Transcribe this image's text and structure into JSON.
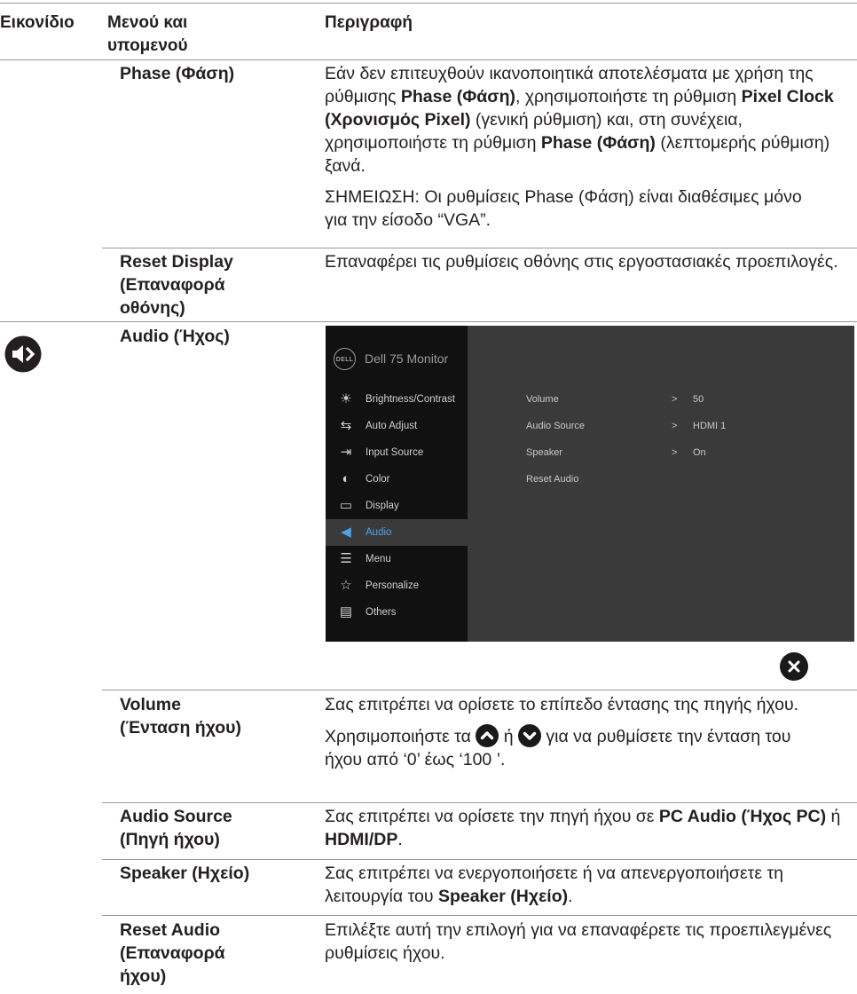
{
  "headers": {
    "icon": "Εικονίδιο",
    "menu": "Μενού και υπομενού",
    "description": "Περιγραφή"
  },
  "rows": {
    "phase": {
      "name": "Phase (Φάση)",
      "d1_a": "Εάν δεν επιτευχθούν ικανοποιητικά αποτελέσματα με χρήση της ρύθμισης ",
      "d1_b": "Phase (Φάση)",
      "d1_c": ", χρησιμοποιήστε τη ρύθμιση ",
      "d1_d": "Pixel Clock (Χρονισμός Pixel)",
      "d1_e": " (γενική ρύθμιση) και, στη συνέχεια, χρησιμοποιήστε τη ρύθμιση ",
      "d1_f": "Phase (Φάση)",
      "d1_g": " (λεπτομερής ρύθμιση) ξανά.",
      "note": "ΣΗΜΕΙΩΣΗ: Οι ρυθμίσεις Phase (Φάση) είναι διαθέσιμες μόνο για την είσοδο “VGA”."
    },
    "reset_display": {
      "name_1": "Reset Display",
      "name_2": "(Επαναφορά",
      "name_3": "οθόνης)",
      "desc": "Επαναφέρει τις ρυθμίσεις οθόνης στις εργοστασιακές προεπιλογές."
    },
    "audio": {
      "name": "Audio (Ήχος)"
    },
    "volume": {
      "name_1": "Volume",
      "name_2": "(Ένταση ήχου)",
      "desc": "Σας επιτρέπει να ορίσετε το επίπεδο έντασης της πηγής ήχου.",
      "d2_a": "Χρησιμοποιήστε τα ",
      "d2_b": " ή ",
      "d2_c": " για να ρυθμίσετε την ένταση του ήχου από ‘0’ έως ‘100 ’."
    },
    "audio_source": {
      "name_1": "Audio Source",
      "name_2": "(Πηγή ήχου)",
      "d_a": "Σας επιτρέπει να ορίσετε την πηγή ήχου σε ",
      "d_b": "PC Audio (Ήχος PC)",
      "d_c": " ή ",
      "d_d": "HDMI/DP",
      "d_e": "."
    },
    "speaker": {
      "name": "Speaker (Ηχείο)",
      "d_a": "Σας επιτρέπει να ενεργοποιήσετε ή να απενεργοποιήσετε τη λειτουργία του ",
      "d_b": "Speaker (Ηχείο)",
      "d_c": "."
    },
    "reset_audio": {
      "name_1": "Reset Audio",
      "name_2": "(Επαναφορά",
      "name_3": "ήχου)",
      "desc": "Επιλέξτε αυτή την επιλογή για να επαναφέρετε τις προεπιλεγμένες ρυθμίσεις ήχου."
    }
  },
  "osd": {
    "logo": "DELL",
    "title": "Dell 75 Monitor",
    "menu": [
      {
        "label": "Brightness/Contrast",
        "icon": "brightness-icon"
      },
      {
        "label": "Auto Adjust",
        "icon": "auto-adjust-icon"
      },
      {
        "label": "Input Source",
        "icon": "input-source-icon"
      },
      {
        "label": "Color",
        "icon": "color-icon"
      },
      {
        "label": "Display",
        "icon": "display-icon"
      },
      {
        "label": "Audio",
        "icon": "audio-icon",
        "active": true
      },
      {
        "label": "Menu",
        "icon": "menu-icon"
      },
      {
        "label": "Personalize",
        "icon": "star-icon"
      },
      {
        "label": "Others",
        "icon": "others-icon"
      }
    ],
    "settings": [
      {
        "label": "Volume",
        "chevron": ">",
        "value": "50"
      },
      {
        "label": "Audio Source",
        "chevron": ">",
        "value": "HDMI 1"
      },
      {
        "label": "Speaker",
        "chevron": ">",
        "value": "On"
      },
      {
        "label": "Reset Audio",
        "chevron": "",
        "value": ""
      }
    ],
    "active_color": "#4ea3e8"
  }
}
